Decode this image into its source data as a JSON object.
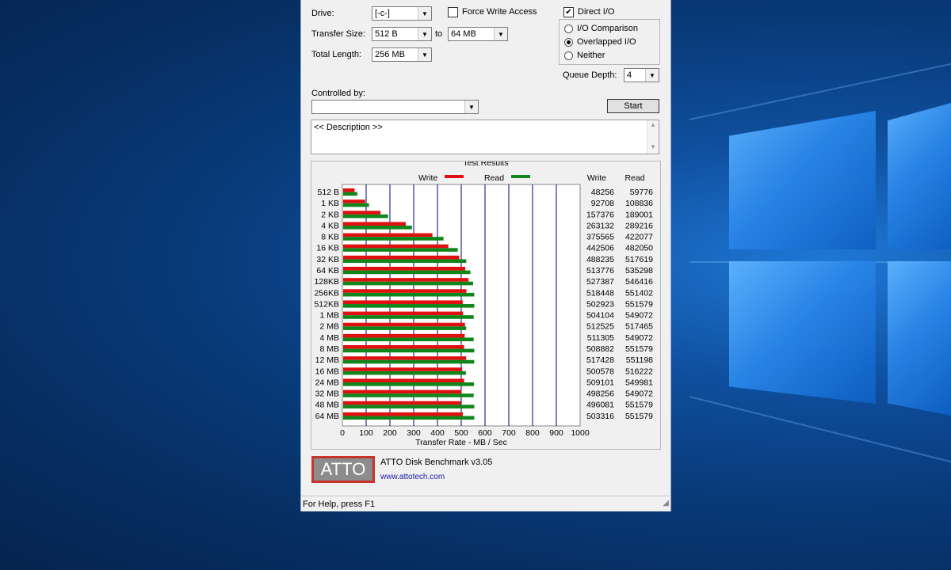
{
  "settings": {
    "drive_label": "Drive:",
    "drive_value": "[-c-]",
    "force_write_label": "Force Write Access",
    "force_write_checked": false,
    "direct_io_label": "Direct I/O",
    "direct_io_checked": true,
    "transfer_size_label": "Transfer Size:",
    "transfer_size_from": "512 B",
    "to_label": "to",
    "transfer_size_to": "64 MB",
    "total_length_label": "Total Length:",
    "total_length_value": "256 MB",
    "io_comparison_label": "I/O Comparison",
    "overlapped_io_label": "Overlapped I/O",
    "neither_label": "Neither",
    "selected_mode": "Overlapped I/O",
    "queue_depth_label": "Queue Depth:",
    "queue_depth_value": "4",
    "controlled_by_label": "Controlled by:",
    "controlled_by_value": "",
    "start_label": "Start",
    "description_text": "<< Description >>"
  },
  "results": {
    "group_title": "Test Results",
    "write_header": "Write",
    "read_header": "Read",
    "colors": {
      "write": "#e01010",
      "read": "#10861a",
      "grid": "#000080"
    }
  },
  "chart_data": {
    "type": "bar",
    "orientation": "horizontal",
    "title": "Test Results",
    "xlabel": "Transfer Rate - MB / Sec",
    "xlim": [
      0,
      1000
    ],
    "xticks": [
      "0",
      "100",
      "200",
      "300",
      "400",
      "500",
      "600",
      "700",
      "800",
      "900",
      "1000"
    ],
    "legend": [
      "Write",
      "Read"
    ],
    "legend_position": "top",
    "categories": [
      "512 B",
      "1 KB",
      "2 KB",
      "4 KB",
      "8 KB",
      "16 KB",
      "32 KB",
      "64 KB",
      "128KB",
      "256KB",
      "512KB",
      "1 MB",
      "2 MB",
      "4 MB",
      "8 MB",
      "12 MB",
      "16 MB",
      "24 MB",
      "32 MB",
      "48 MB",
      "64 MB"
    ],
    "series": [
      {
        "name": "Write",
        "values": [
          48256,
          92708,
          157376,
          263132,
          375565,
          442506,
          488235,
          513776,
          527387,
          518448,
          502923,
          504104,
          512525,
          511305,
          508882,
          517428,
          500578,
          509101,
          498256,
          496081,
          503316
        ]
      },
      {
        "name": "Read",
        "values": [
          59776,
          108836,
          189001,
          289216,
          422077,
          482050,
          517619,
          535298,
          546416,
          551402,
          551579,
          549072,
          517465,
          549072,
          551579,
          551198,
          516222,
          549981,
          549072,
          551579,
          551579
        ]
      }
    ]
  },
  "footer": {
    "logo_text": "ATTO",
    "product_name": "ATTO Disk Benchmark v3.05",
    "website": "www.attotech.com"
  },
  "statusbar": {
    "text": "For Help, press F1"
  }
}
